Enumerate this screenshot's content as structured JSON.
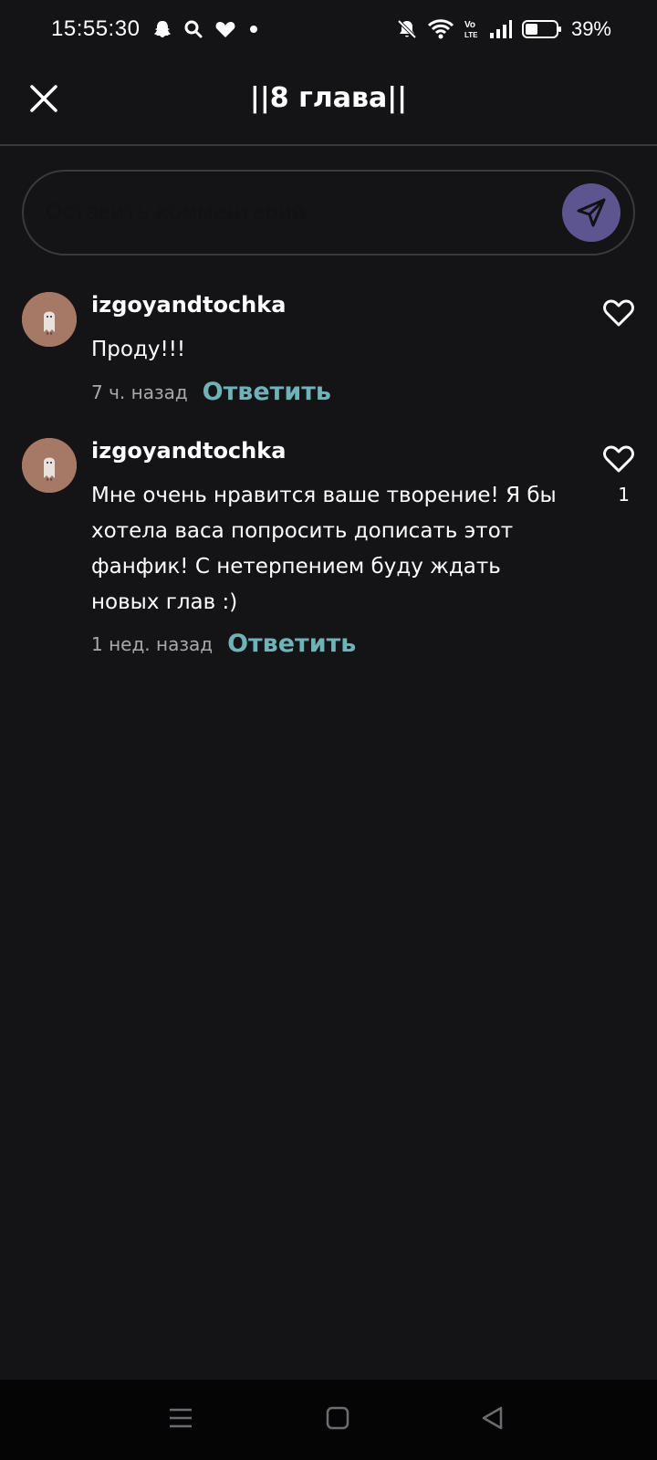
{
  "status_bar": {
    "time": "15:55:30",
    "battery": "39%",
    "left_icons": [
      "snapchat-icon",
      "search-icon",
      "heart-icon",
      "dot-icon"
    ],
    "right_icons": [
      "mute-icon",
      "wifi-icon",
      "volte-icon",
      "signal-icon",
      "battery-icon"
    ]
  },
  "header": {
    "title": "||8 глава||",
    "close_icon": "close-icon"
  },
  "comment_box": {
    "placeholder": "Оставить комментарий...",
    "value": "",
    "send_icon": "send-icon"
  },
  "comments": [
    {
      "username": "izgoyandtochka",
      "text": "Проду!!!",
      "time": "7 ч. назад",
      "reply_label": "Ответить",
      "likes": ""
    },
    {
      "username": "izgoyandtochka",
      "text": "Мне очень нравится ваше творение! Я бы хотела васа попросить дописать этот фанфик! С нетерпением буду ждать новых глав :)",
      "time": "1 нед. назад",
      "reply_label": "Ответить",
      "likes": "1"
    }
  ],
  "colors": {
    "background": "#141316",
    "accent": "#6fb3b8",
    "send_button": "#5d5590",
    "avatar": "#a67866"
  },
  "nav_bar": {
    "icons": [
      "menu-icon",
      "home-icon",
      "back-icon"
    ]
  }
}
